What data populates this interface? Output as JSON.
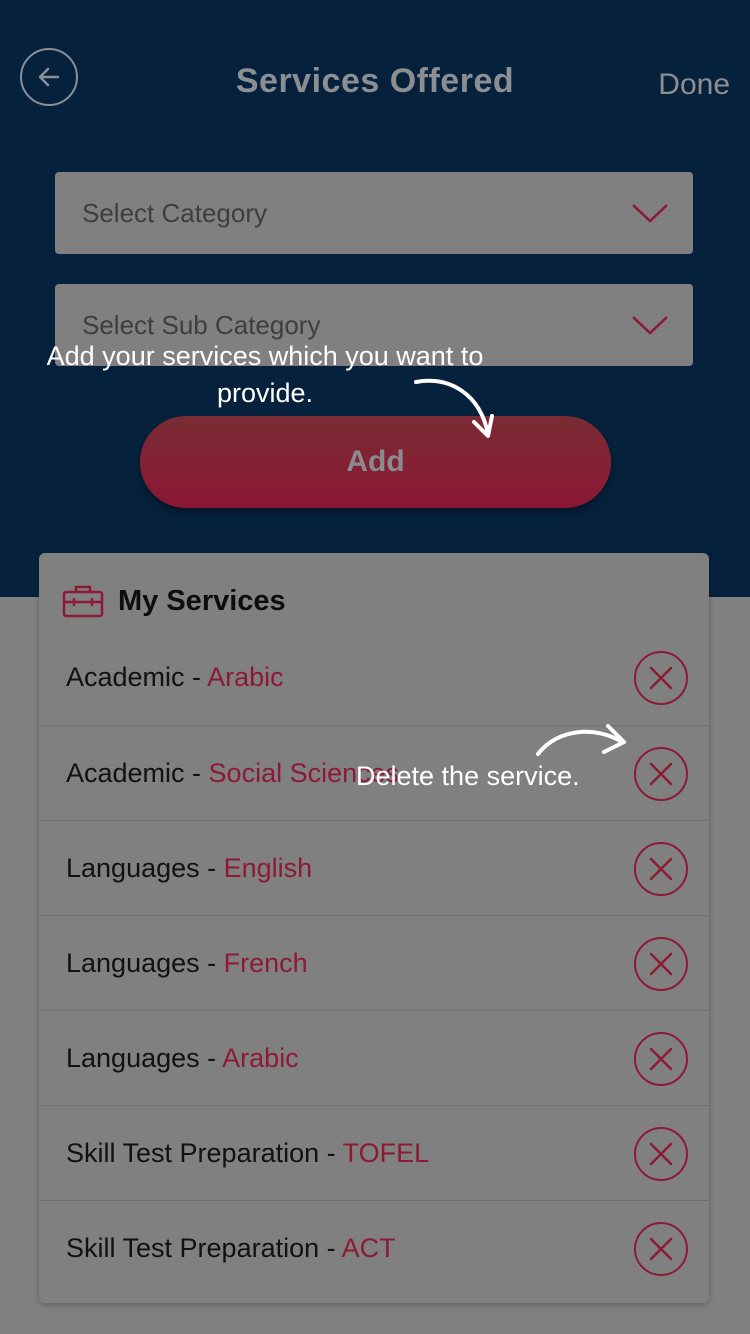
{
  "header": {
    "title": "Services Offered",
    "done_label": "Done",
    "back_icon": "arrow-left-icon",
    "background_color": "#06213c"
  },
  "form": {
    "category_placeholder": "Select Category",
    "subcategory_placeholder": "Select Sub Category",
    "add_label": "Add"
  },
  "my_services": {
    "title": "My Services",
    "icon": "briefcase-icon",
    "items": [
      {
        "category": "Academic",
        "sub": "Arabic"
      },
      {
        "category": "Academic",
        "sub": "Social Sciences"
      },
      {
        "category": "Languages",
        "sub": "English"
      },
      {
        "category": "Languages",
        "sub": "French"
      },
      {
        "category": "Languages",
        "sub": "Arabic"
      },
      {
        "category": "Skill Test Preparation",
        "sub": "TOFEL"
      },
      {
        "category": "Skill Test Preparation",
        "sub": "ACT"
      }
    ],
    "separator": " - "
  },
  "tooltips": {
    "add_tip": "Add your services which you want to provide.",
    "delete_tip": "Delete the service."
  },
  "colors": {
    "accent": "#8d1a35",
    "overlay": "#808080"
  }
}
